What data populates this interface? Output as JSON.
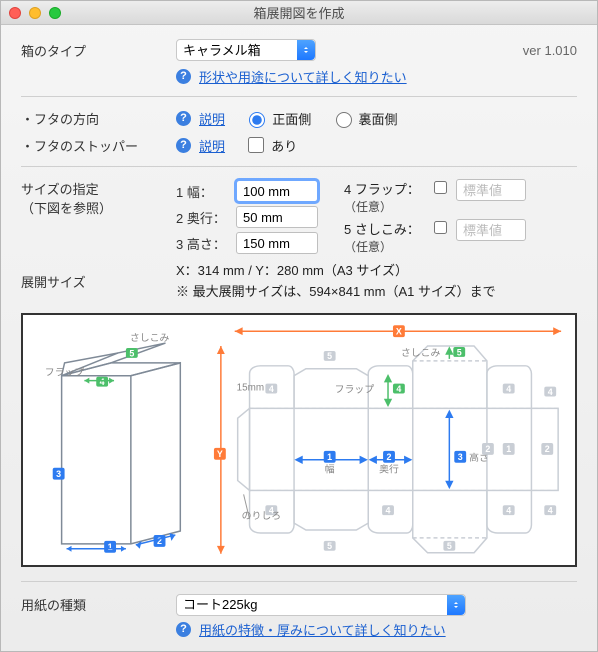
{
  "window": {
    "title": "箱展開図を作成"
  },
  "version": "ver 1.010",
  "type_section": {
    "label": "箱のタイプ",
    "select": "キャラメル箱",
    "help": "?",
    "details_link": "形状や用途について詳しく知りたい"
  },
  "lid": {
    "direction_label": "・フタの方向",
    "stopper_label": "・フタのストッパー",
    "explain": "説明",
    "front": "正面側",
    "back": "裏面側",
    "has_stopper": "あり"
  },
  "size": {
    "label": "サイズの指定",
    "sublabel": "（下図を参照）",
    "w_label": "1 幅：",
    "d_label": "2 奥行：",
    "h_label": "3 高さ：",
    "w_value": "100 mm",
    "d_value": "50 mm",
    "h_value": "150 mm",
    "flap_label": "4 フラップ：",
    "tuck_label": "5 さしこみ：",
    "optional": "（任意）",
    "placeholder": "標準値"
  },
  "expand": {
    "label": "展開サイズ",
    "line1": "X：314 mm / Y：280 mm（A3 サイズ）",
    "line2": "※ 最大展開サイズは、594×841 mm（A1 サイズ）まで"
  },
  "paper": {
    "label": "用紙の種類",
    "select": "コート225kg",
    "details_link": "用紙の特徴・厚みについて詳しく知りたい"
  },
  "diagram_labels": {
    "sasikomi": "さしこみ",
    "flap": "フラップ",
    "width": "幅",
    "depth": "奥行",
    "height": "高さ",
    "norishiro": "のりしろ",
    "mm15": "15mm",
    "x": "X",
    "y": "Y"
  }
}
